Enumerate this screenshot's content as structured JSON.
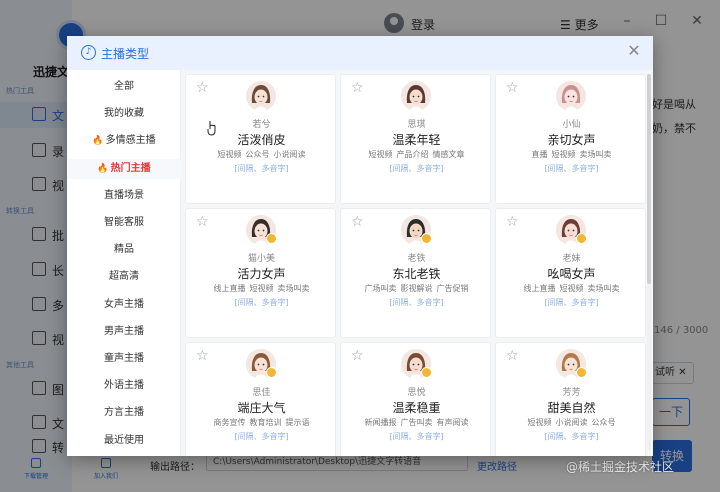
{
  "app": {
    "name": "迅捷文",
    "login": "登录",
    "more": "更多",
    "sections": [
      "热门工具",
      "转换工具",
      "其他工具"
    ],
    "nav": [
      "文",
      "录",
      "视",
      "批",
      "长",
      "多",
      "视",
      "图",
      "文",
      "转"
    ],
    "footer": [
      "下载管理",
      "加入我们"
    ],
    "right_texts": [
      "好是喝从",
      "奶，禁不"
    ],
    "counter": "146 / 3000",
    "try_listen": "试听",
    "next": "一下",
    "convert": "转换",
    "output_label": "输出路径：",
    "output_path": "C:\\Users\\Administrator\\Desktop\\迅捷文字转语音",
    "change_path": "更改路径",
    "watermark": "@稀土掘金技术社区"
  },
  "modal": {
    "title": "主播类型",
    "close_icon": "close-icon",
    "categories": [
      {
        "label": "全部",
        "hot": false,
        "active": false
      },
      {
        "label": "我的收藏",
        "hot": false,
        "active": false
      },
      {
        "label": "多情感主播",
        "hot": true,
        "active": false
      },
      {
        "label": "热门主播",
        "hot": true,
        "active": true
      },
      {
        "label": "直播场景",
        "hot": false,
        "active": false
      },
      {
        "label": "智能客服",
        "hot": false,
        "active": false
      },
      {
        "label": "精品",
        "hot": false,
        "active": false
      },
      {
        "label": "超高清",
        "hot": false,
        "active": false
      },
      {
        "label": "女声主播",
        "hot": false,
        "active": false
      },
      {
        "label": "男声主播",
        "hot": false,
        "active": false
      },
      {
        "label": "童声主播",
        "hot": false,
        "active": false
      },
      {
        "label": "外语主播",
        "hot": false,
        "active": false
      },
      {
        "label": "方言主播",
        "hot": false,
        "active": false
      },
      {
        "label": "最近使用",
        "hot": false,
        "active": false
      }
    ],
    "voices": [
      {
        "name": "若兮",
        "title": "活泼俏皮",
        "tags": [
          "短视频",
          "公众号",
          "小说阅读"
        ],
        "features": "[间隔、多音字]",
        "badge": false,
        "hair": "#6b4a3a",
        "skin": "#f7e2d6"
      },
      {
        "name": "思琪",
        "title": "温柔年轻",
        "tags": [
          "短视频",
          "产品介绍",
          "情感文章"
        ],
        "features": "[间隔、多音字]",
        "badge": false,
        "hair": "#5a3a2c",
        "skin": "#f5ddcf"
      },
      {
        "name": "小仙",
        "title": "亲切女声",
        "tags": [
          "直播",
          "短视频",
          "卖场叫卖"
        ],
        "features": "[间隔、多音字]",
        "badge": false,
        "hair": "#c9908e",
        "skin": "#f9e4e1"
      },
      {
        "name": "猫小美",
        "title": "活力女声",
        "tags": [
          "线上直播",
          "短视频",
          "卖场叫卖"
        ],
        "features": "[间隔、多音字]",
        "badge": true,
        "hair": "#3a2a2a",
        "skin": "#f7e2d6"
      },
      {
        "name": "老铁",
        "title": "东北老铁",
        "tags": [
          "广场叫卖",
          "影视解说",
          "广告促销"
        ],
        "features": "[间隔、多音字]",
        "badge": true,
        "hair": "#2c2c2c",
        "skin": "#f1d9c6"
      },
      {
        "name": "老妹",
        "title": "吆喝女声",
        "tags": [
          "线上直播",
          "短视频",
          "卖场叫卖"
        ],
        "features": "[间隔、多音字]",
        "badge": true,
        "hair": "#6b3e35",
        "skin": "#f6dcd2"
      },
      {
        "name": "思佳",
        "title": "端庄大气",
        "tags": [
          "商务宣传",
          "教育培训",
          "提示语"
        ],
        "features": "[间隔、多音字]",
        "badge": true,
        "hair": "#8a5a3a",
        "skin": "#f7e2d6"
      },
      {
        "name": "思悦",
        "title": "温柔稳重",
        "tags": [
          "新闻播报",
          "广告叫卖",
          "有声阅读"
        ],
        "features": "[间隔、多音字]",
        "badge": true,
        "hair": "#7a4a32",
        "skin": "#f5ddcf"
      },
      {
        "name": "芳芳",
        "title": "甜美自然",
        "tags": [
          "短视频",
          "小说阅读",
          "公众号"
        ],
        "features": "[间隔、多音字]",
        "badge": true,
        "hair": "#b07a4a",
        "skin": "#f7e2d6"
      }
    ]
  },
  "colors": {
    "accent": "#2b6fe0",
    "hot": "#e53935",
    "badge": "#f2b632"
  }
}
